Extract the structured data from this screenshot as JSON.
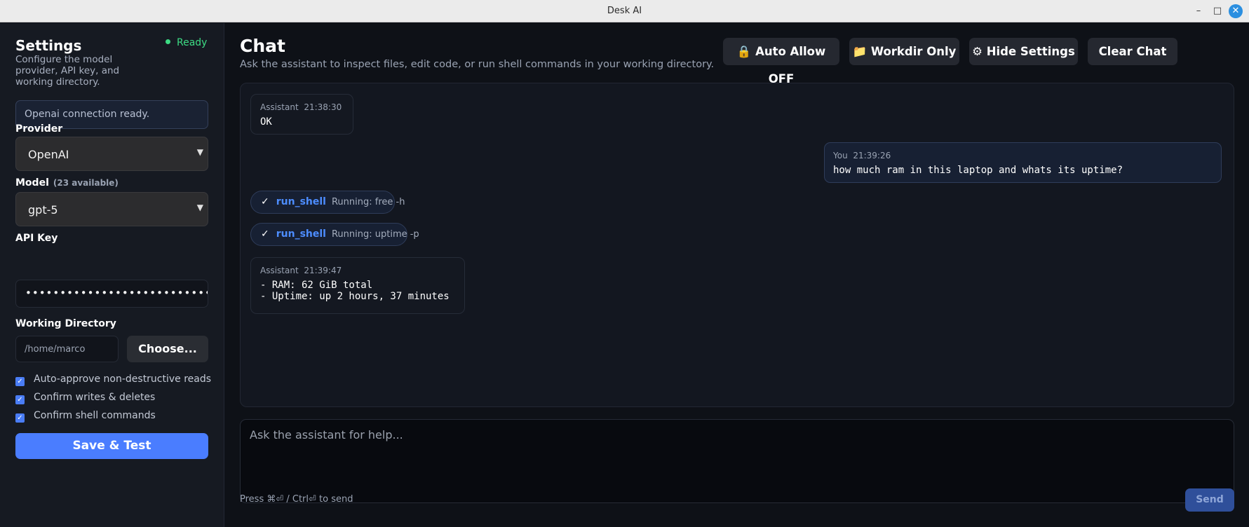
{
  "window": {
    "title": "Desk AI",
    "minimize": "–",
    "maximize": "□",
    "close": "✕"
  },
  "sidebar": {
    "title": "Settings",
    "status": "Ready",
    "description": "Configure the model provider, API key, and working directory.",
    "connection_message": "Openai connection ready.",
    "provider_label": "Provider",
    "provider_value": "OpenAI",
    "model_label": "Model",
    "model_count": "(23 available)",
    "model_value": "gpt-5",
    "apikey_label": "API Key",
    "apikey_value": "••••••••••••••••••••••••••••••••••",
    "workdir_label": "Working Directory",
    "workdir_value": "/home/marco",
    "choose_label": "Choose...",
    "checkboxes": [
      {
        "label": "Auto-approve non-destructive reads",
        "checked": true
      },
      {
        "label": "Confirm writes & deletes",
        "checked": true
      },
      {
        "label": "Confirm shell commands",
        "checked": true
      }
    ],
    "save_label": "Save & Test"
  },
  "main": {
    "title": "Chat",
    "subtitle": "Ask the assistant to inspect files, edit code, or run shell commands in your working directory.",
    "toolbar": {
      "auto_allow": "🔒 Auto Allow OFF",
      "workdir_only": "📁 Workdir Only",
      "hide_settings": "⚙ Hide Settings",
      "clear_chat": "Clear Chat"
    },
    "messages": [
      {
        "role": "Assistant",
        "time": "21:38:30",
        "text": "OK"
      },
      {
        "role": "You",
        "time": "21:39:26",
        "text": "how much ram in this laptop and whats its uptime?"
      },
      {
        "role": "Assistant",
        "time": "21:39:47",
        "text": "- RAM: 62 GiB total\n- Uptime: up 2 hours, 37 minutes"
      }
    ],
    "tools": [
      {
        "check": "✓",
        "name": "run_shell",
        "status": "Running: free -h"
      },
      {
        "check": "✓",
        "name": "run_shell",
        "status": "Running: uptime -p"
      }
    ],
    "input_placeholder": "Ask the assistant for help...",
    "hint": "Press ⌘⏎ / Ctrl⏎ to send",
    "send_label": "Send"
  },
  "colors": {
    "accent": "#4a7dff",
    "status_ok": "#3ddc84",
    "tool_name": "#4d8dff"
  }
}
